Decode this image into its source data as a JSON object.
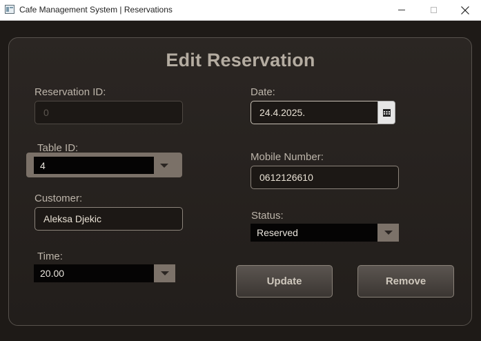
{
  "window": {
    "title": "Cafe Management System | Reservations"
  },
  "heading": "Edit Reservation",
  "form": {
    "reservation_id": {
      "label": "Reservation ID:",
      "value": "0"
    },
    "table_id": {
      "label": "Table ID:",
      "value": "4"
    },
    "customer": {
      "label": "Customer:",
      "value": "Aleksa Djekic"
    },
    "time": {
      "label": "Time:",
      "value": "20.00"
    },
    "date": {
      "label": "Date:",
      "value": "24.4.2025."
    },
    "mobile": {
      "label": "Mobile Number:",
      "value": "0612126610"
    },
    "status": {
      "label": "Status:",
      "value": "Reserved"
    }
  },
  "buttons": {
    "update": "Update",
    "remove": "Remove"
  },
  "icons": {
    "calendar": "calendar-icon",
    "dropdown": "chevron-down-icon"
  },
  "colors": {
    "background": "#1e1a17",
    "panel_border": "#57524d",
    "text": "#bdb5aa",
    "combo_arrow": "#7c7269"
  }
}
